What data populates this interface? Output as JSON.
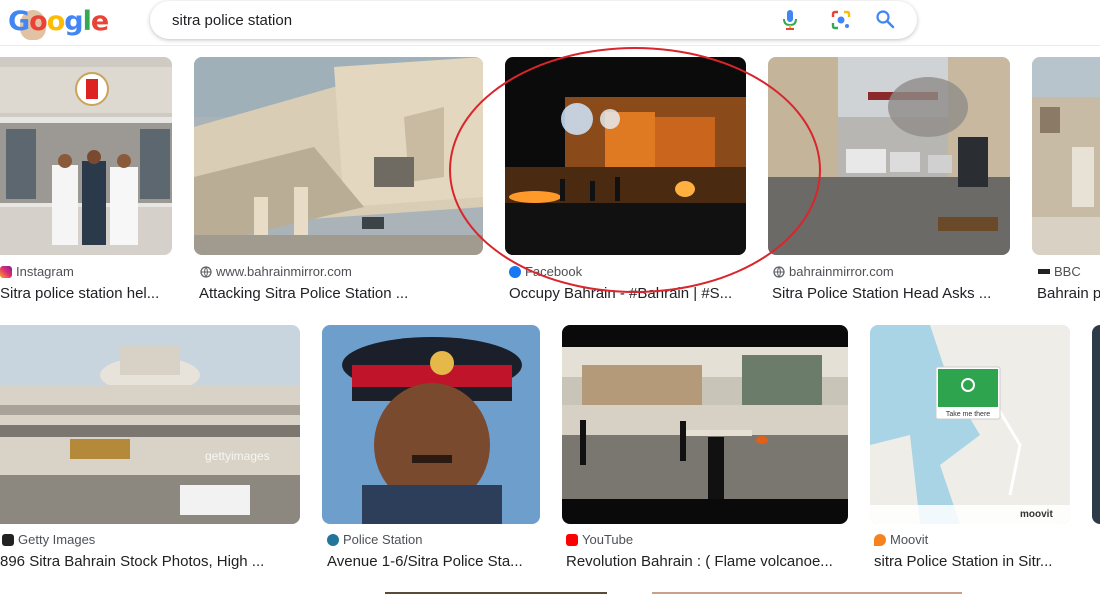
{
  "logo_text": "Google",
  "search": {
    "query": "sitra police station"
  },
  "icons": {
    "mic": "mic-icon",
    "lens": "google-lens-icon",
    "search": "search-icon"
  },
  "row1": [
    {
      "source": "Instagram",
      "caption": "Sitra police station hel...",
      "fav_icon": "instagram-icon"
    },
    {
      "source": "www.bahrainmirror.com",
      "caption": "Attacking Sitra Police Station ...",
      "fav_icon": "globe-icon"
    },
    {
      "source": "Facebook",
      "caption": "Occupy Bahrain - #Bahrain | #S...",
      "fav_icon": "facebook-icon"
    },
    {
      "source": "bahrainmirror.com",
      "caption": "Sitra Police Station Head Asks ...",
      "fav_icon": "globe-icon"
    },
    {
      "source": "BBC",
      "caption": "Bahrain p",
      "fav_icon": "bbc-icon"
    }
  ],
  "row2": [
    {
      "source": "Getty Images",
      "caption": "896 Sitra Bahrain Stock Photos, High ...",
      "fav_icon": "getty-icon",
      "watermark": "gettyimages"
    },
    {
      "source": "Police Station",
      "caption": "Avenue 1-6/Sitra Police Sta...",
      "fav_icon": "wordpress-icon"
    },
    {
      "source": "YouTube",
      "caption": "Revolution Bahrain : ( Flame volcanoe...",
      "fav_icon": "youtube-icon"
    },
    {
      "source": "Moovit",
      "caption": "sitra Police Station in Sitr...",
      "fav_icon": "moovit-pin-icon",
      "map_button": "Take me there",
      "brand": "moovit"
    }
  ],
  "colors": {
    "annotation_circle": "#d9252b",
    "link_text": "#4d5156"
  }
}
